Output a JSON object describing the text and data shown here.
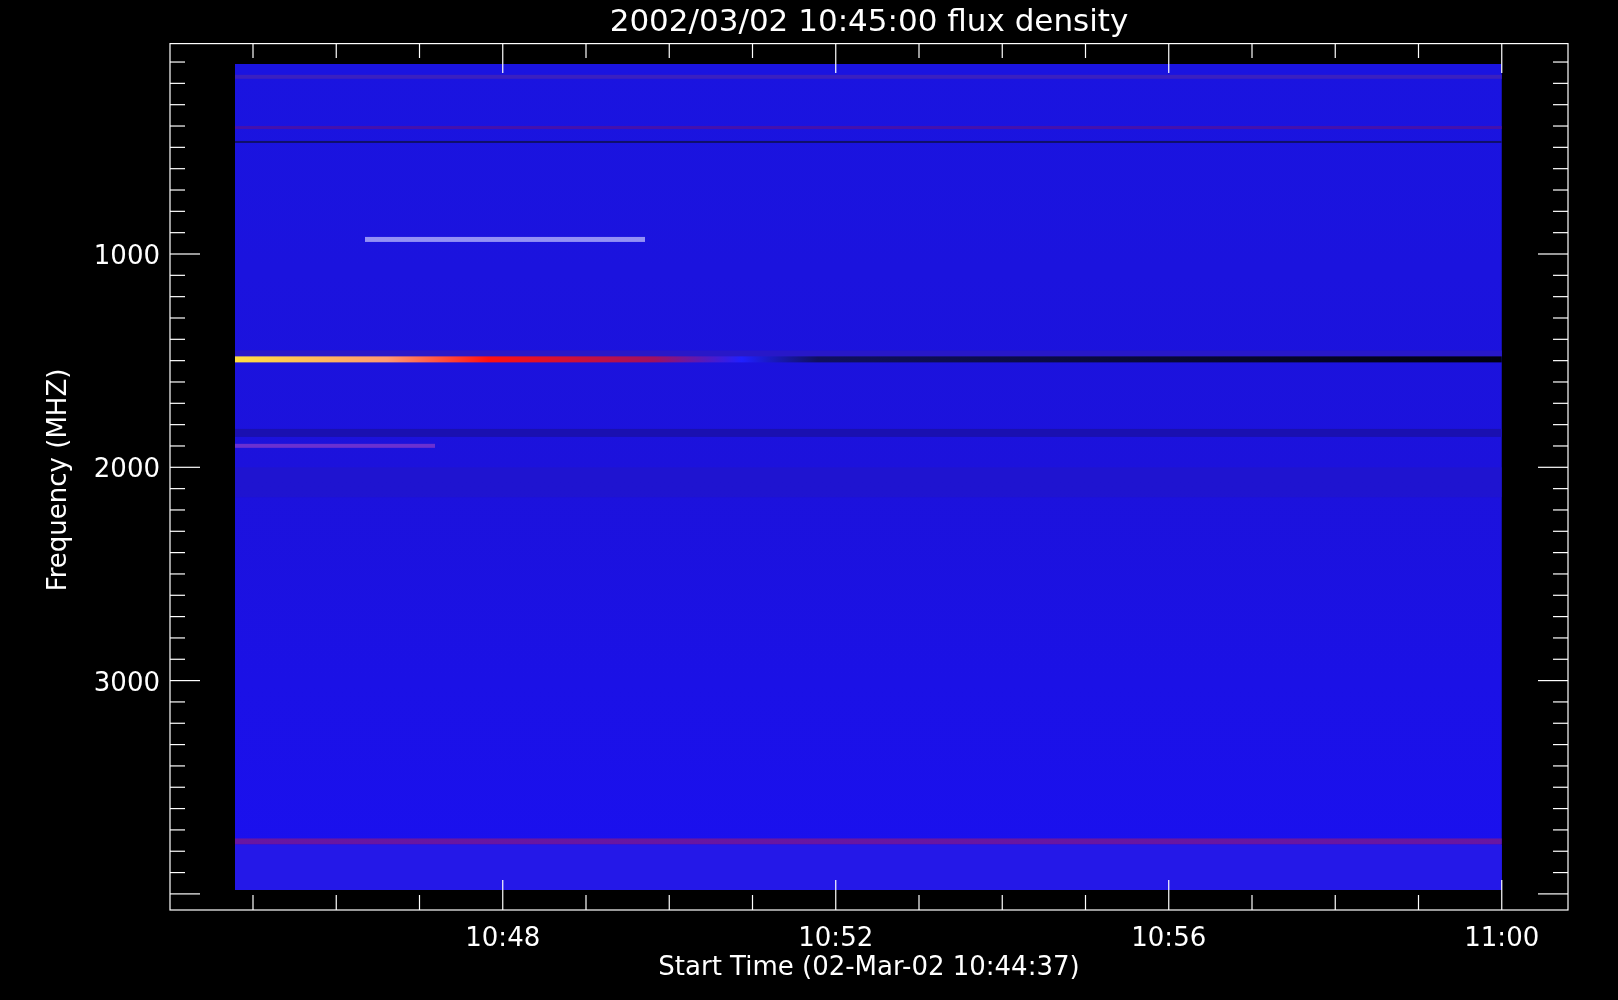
{
  "plot": {
    "title": "2002/03/02 10:45:00 flux density",
    "xlabel": "Start Time (02-Mar-02 10:44:37)",
    "ylabel": "Frequency (MHZ)",
    "xticks": [
      "10:48",
      "10:52",
      "10:56",
      "11:00"
    ],
    "yticks": [
      "1000",
      "2000",
      "3000"
    ]
  }
}
